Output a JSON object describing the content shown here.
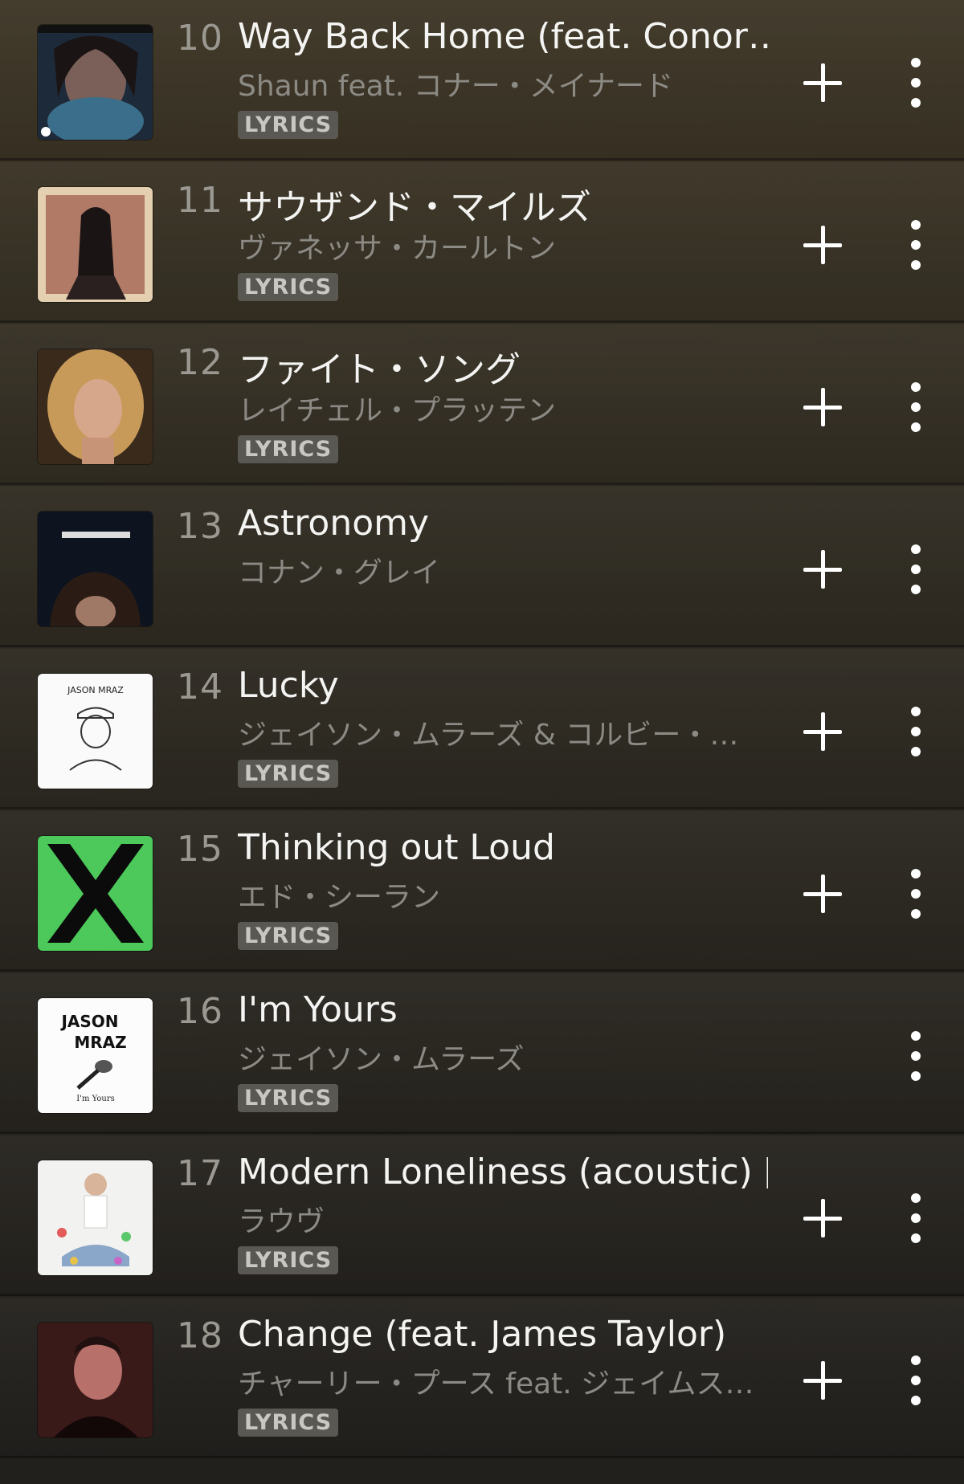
{
  "badge_label": "LYRICS",
  "tracks": [
    {
      "num": "10",
      "title": "Way Back Home (feat. Conor…",
      "artist": "Shaun feat. コナー・メイナード",
      "lyrics": true,
      "add": true,
      "art": "shaun-cover"
    },
    {
      "num": "11",
      "title": "サウザンド・マイルズ",
      "artist": "ヴァネッサ・カールトン",
      "lyrics": true,
      "add": true,
      "art": "vanessa-carlton-cover"
    },
    {
      "num": "12",
      "title": "ファイト・ソング",
      "artist": "レイチェル・プラッテン",
      "lyrics": true,
      "add": true,
      "art": "rachel-platten-cover"
    },
    {
      "num": "13",
      "title": "Astronomy",
      "artist": "コナン・グレイ",
      "lyrics": false,
      "add": true,
      "art": "conan-gray-cover"
    },
    {
      "num": "14",
      "title": "Lucky",
      "artist": "ジェイソン・ムラーズ & コルビー・…",
      "lyrics": true,
      "add": true,
      "art": "jason-mraz-sketch-cover"
    },
    {
      "num": "15",
      "title": "Thinking out Loud",
      "artist": "エド・シーラン",
      "lyrics": true,
      "add": true,
      "art": "ed-sheeran-x-cover"
    },
    {
      "num": "16",
      "title": "I'm Yours",
      "artist": "ジェイソン・ムラーズ",
      "lyrics": true,
      "add": false,
      "art": "jason-mraz-mic-cover"
    },
    {
      "num": "17",
      "title": "Modern Loneliness (acoustic) […",
      "artist": "ラウヴ",
      "lyrics": true,
      "add": true,
      "art": "lauv-cover"
    },
    {
      "num": "18",
      "title": "Change (feat. James Taylor)",
      "artist": "チャーリー・プース feat. ジェイムス…",
      "lyrics": true,
      "add": true,
      "art": "charlie-puth-cover"
    }
  ],
  "art_text": {
    "jason_mraz_1": "JASON MRAZ",
    "jason_mraz_2a": "JASON",
    "jason_mraz_2b": "MRAZ",
    "im_yours": "I'm Yours"
  },
  "colors": {
    "title": "#f4f4f2",
    "artist": "#8c8a84",
    "number": "#9a9890",
    "badge_bg": "#5a5852",
    "ed_green": "#4cc95a"
  }
}
